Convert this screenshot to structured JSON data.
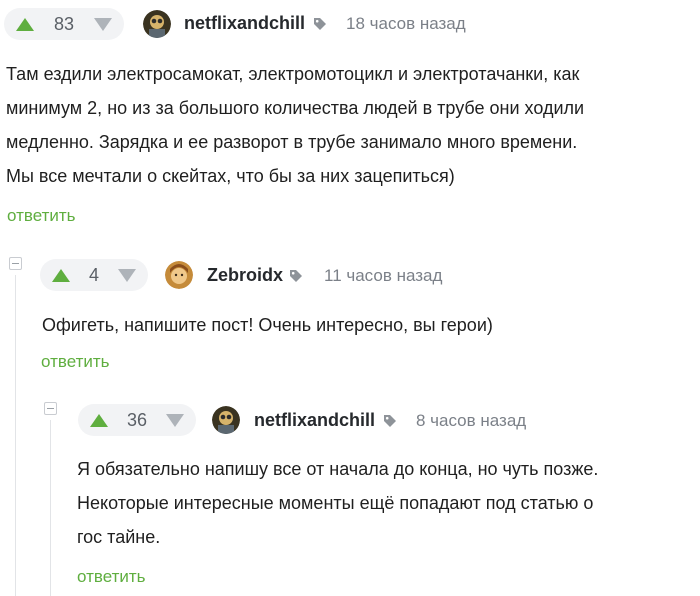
{
  "comments": [
    {
      "score": "83",
      "username": "netflixandchill",
      "time": "18 часов назад",
      "lines": [
        "Там ездили электросамокат, электромотоцикл и электротачанки, как",
        "минимум 2, но из за большого количества людей в трубе они ходили",
        "медленно. Зарядка и ее разворот в трубе занимало много времени.",
        "Мы все мечтали о скейтах, что бы за них зацепиться)"
      ],
      "reply": "ответить"
    },
    {
      "score": "4",
      "username": "Zebroidx",
      "time": "11 часов назад",
      "lines": [
        "Офигеть, напишите пост! Очень интересно, вы герои)"
      ],
      "reply": "ответить"
    },
    {
      "score": "36",
      "username": "netflixandchill",
      "time": "8 часов назад",
      "lines": [
        "Я обязательно напишу все от начала до конца, но чуть позже.",
        "Некоторые интересные моменты ещё попадают под статью о",
        "гос тайне."
      ],
      "reply": "ответить"
    }
  ],
  "colors": {
    "accent": "#5fae3f",
    "muted": "#7b8088",
    "vote_bg": "#f2f3f5"
  },
  "icons": {
    "upvote": "arrow-up-icon",
    "downvote": "arrow-down-icon",
    "tag": "tag-icon",
    "collapse": "minus-box-icon"
  }
}
